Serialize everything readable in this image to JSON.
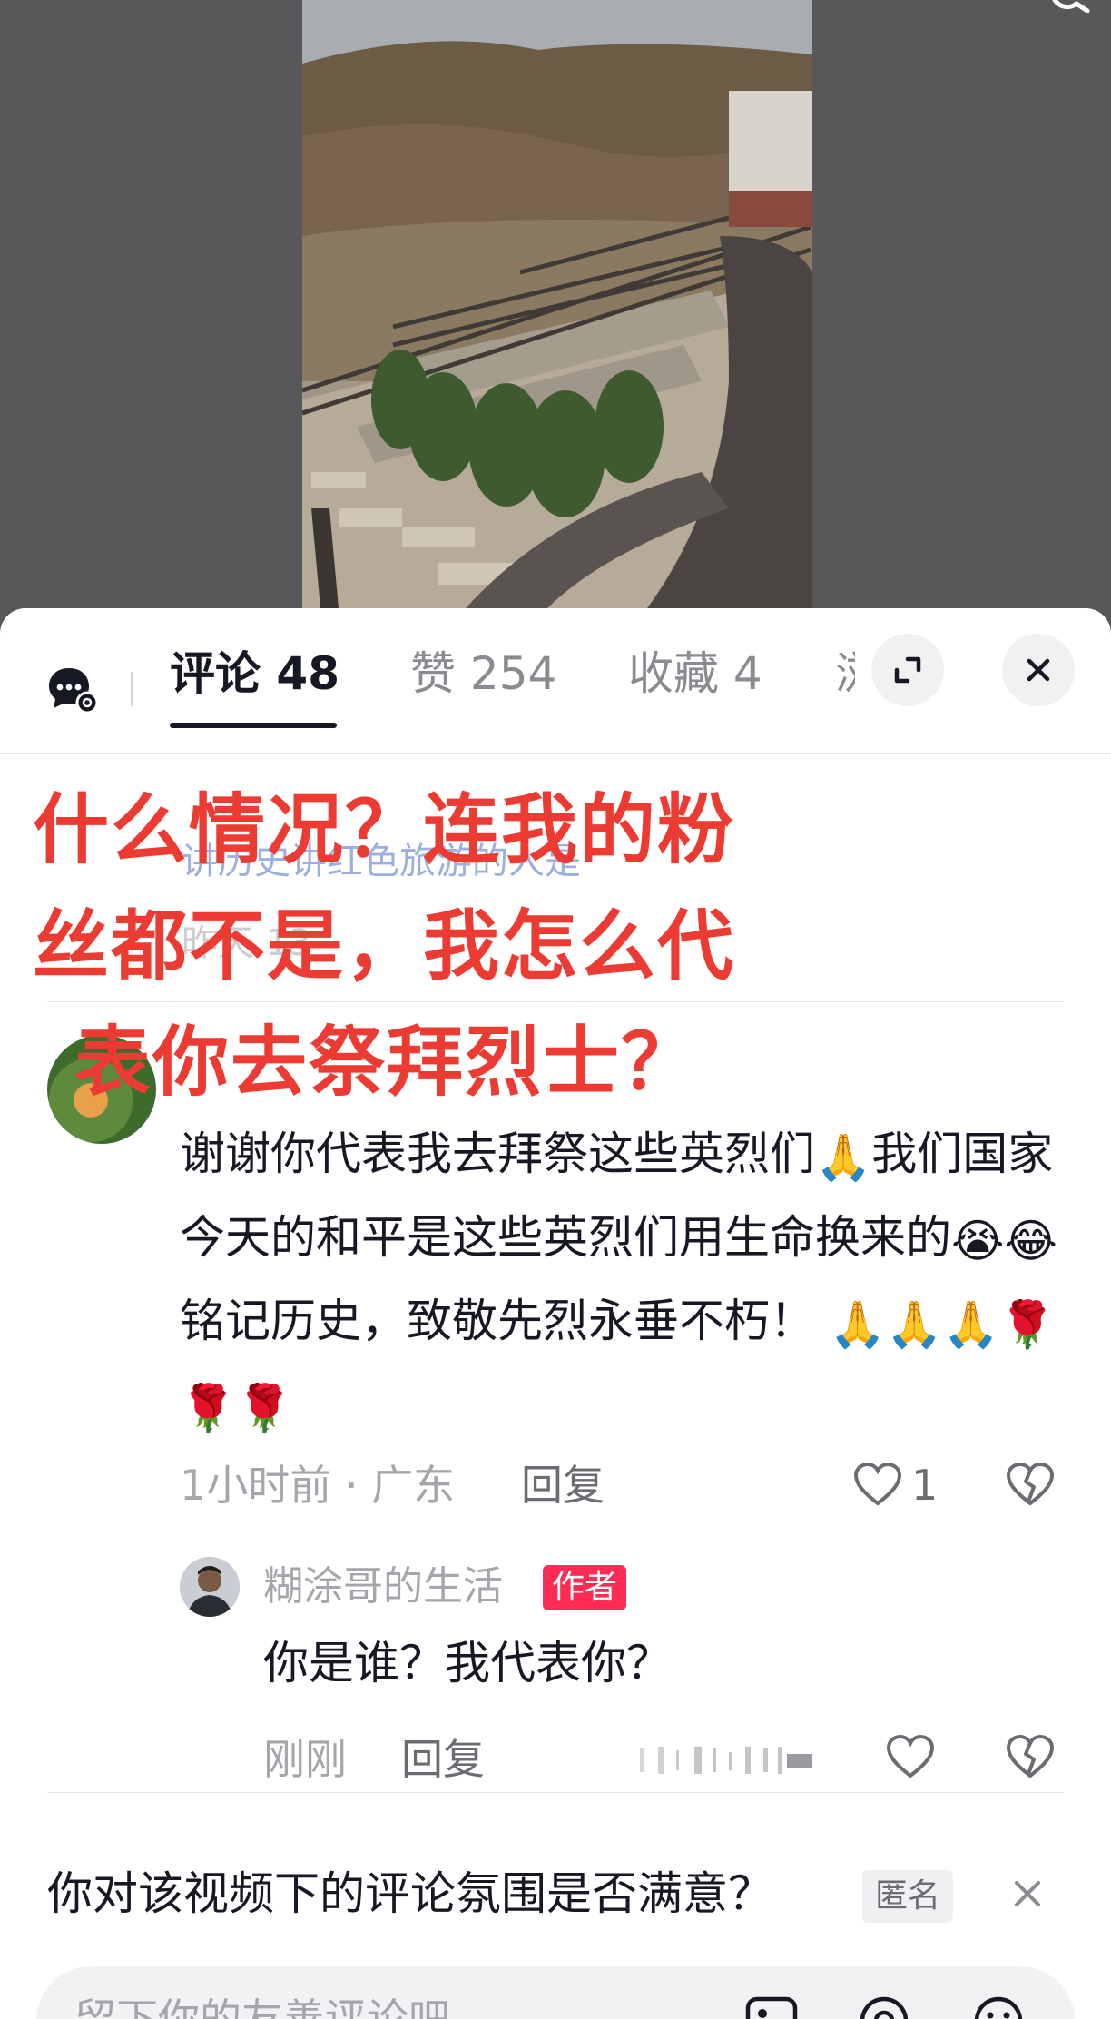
{
  "tabs": [
    {
      "label": "评论 48",
      "active": true
    },
    {
      "label": "赞 254",
      "active": false
    },
    {
      "label": "收藏 4",
      "active": false
    },
    {
      "label": "浏",
      "active": false
    }
  ],
  "overlay": {
    "lines": [
      "什么情况？连我的粉",
      "丝都不是，我怎么代",
      "表你去祭拜烈士？"
    ],
    "color": "#ec3b33"
  },
  "ghost": {
    "line1": "讲历史讲红色旅游的人是",
    "line2": "昨天 13"
  },
  "comment": {
    "text_parts": [
      "谢谢你代表我去拜祭这些英烈们",
      "我们国家今天的和平是这些英烈们用生命换来的",
      "铭记历史，致敬先烈永垂不朽！"
    ],
    "emojis": {
      "pray": "🙏",
      "cry": "😭",
      "laugh": "😂",
      "rose": "🌹"
    },
    "time_location": "1小时前 · 广东",
    "reply_label": "回复",
    "likes": "1"
  },
  "reply": {
    "author": "糊涂哥的生活",
    "badge": "作者",
    "text": "你是谁？我代表你？",
    "time": "刚刚",
    "reply_label": "回复"
  },
  "survey": {
    "question": "你对该视频下的评论氛围是否满意？",
    "badge": "匿名"
  },
  "input": {
    "placeholder": "留下你的友善评论吧"
  },
  "colors": {
    "accent": "#fe2c55",
    "text": "#161823",
    "muted": "#a5a6ab"
  },
  "icons": [
    "ai-assistant-icon",
    "expand-icon",
    "close-icon",
    "heart-icon",
    "broken-heart-icon",
    "image-icon",
    "at-icon",
    "emoji-icon"
  ]
}
